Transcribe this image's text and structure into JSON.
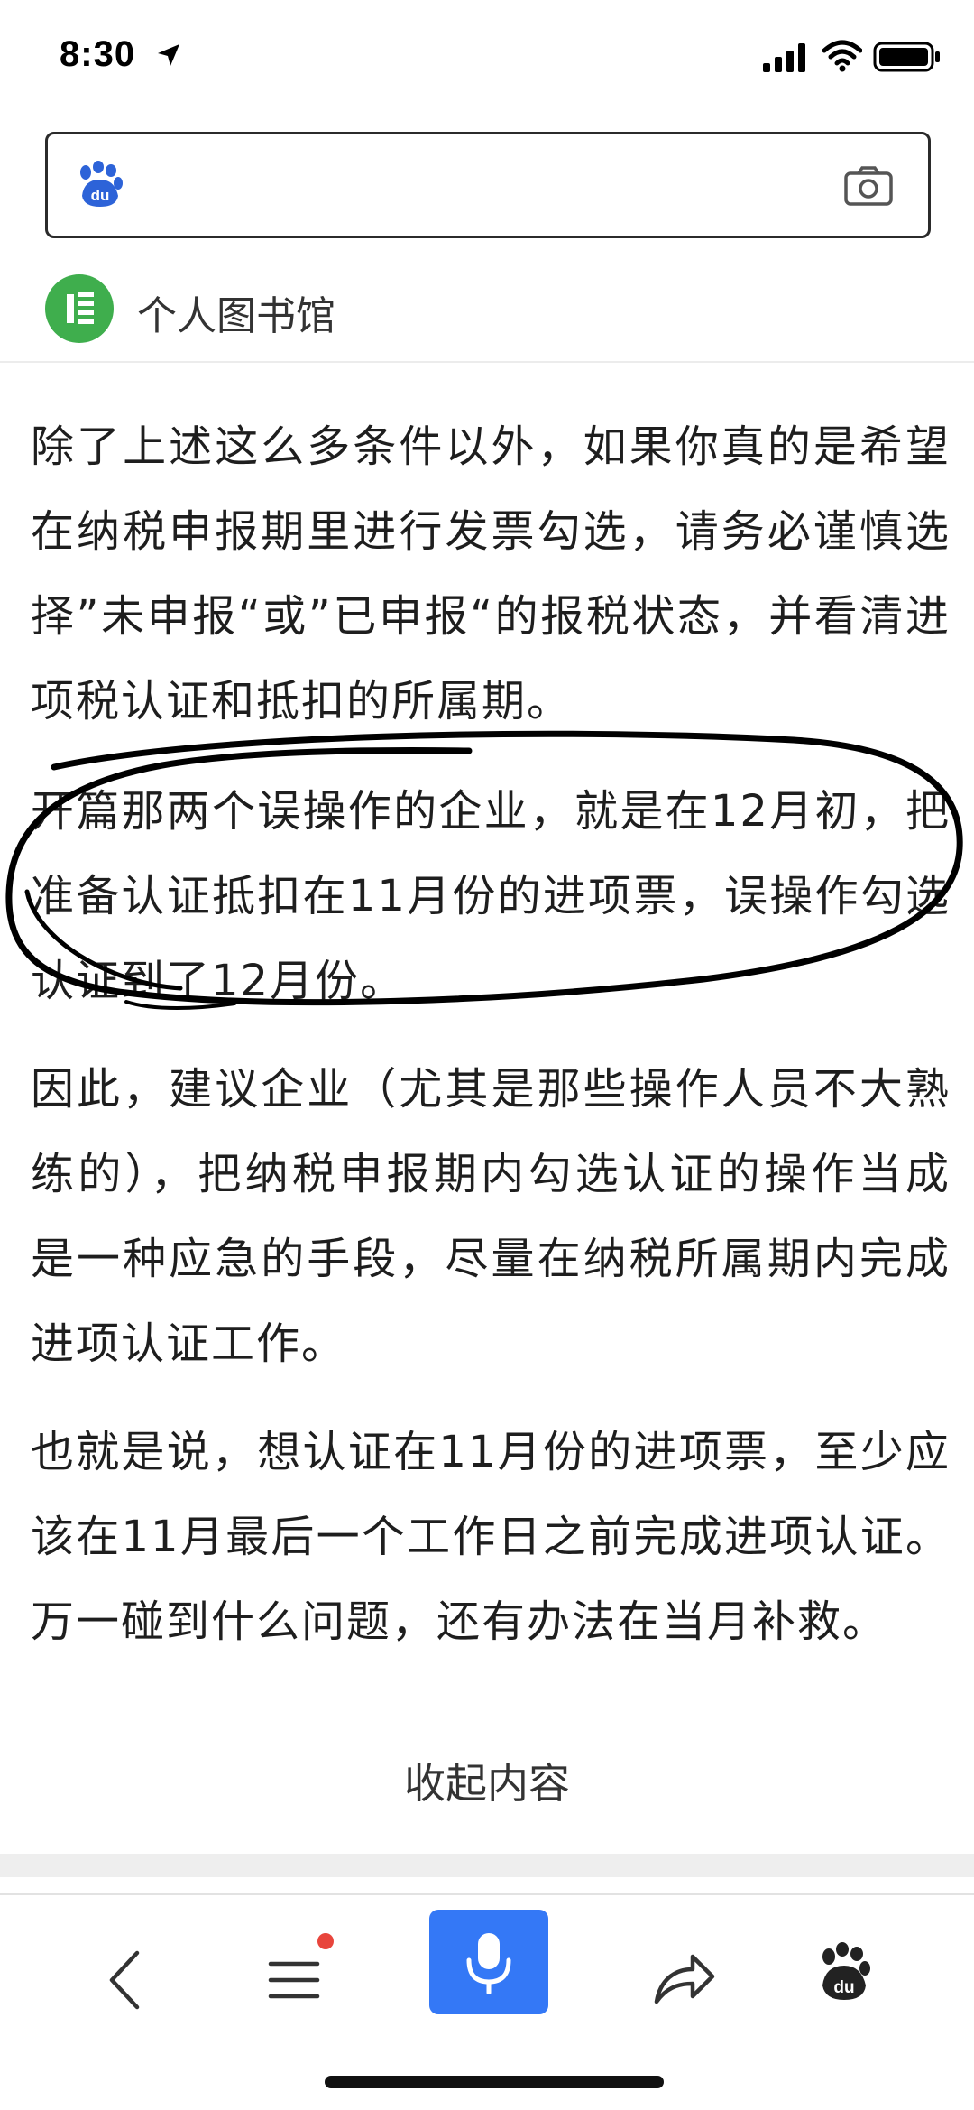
{
  "status_bar": {
    "time": "8:30"
  },
  "search": {
    "placeholder": ""
  },
  "source": {
    "name": "个人图书馆"
  },
  "article": {
    "paragraphs": [
      "除了上述这么多条件以外，如果你真的是希望在纳税申报期里进行发票勾选，请务必谨慎选择”未申报“或”已申报“的报税状态，并看清进项税认证和抵扣的所属期。",
      "开篇那两个误操作的企业，就是在12月初，把准备认证抵扣在11月份的进项票，误操作勾选认证到了12月份。",
      "因此，建议企业（尤其是那些操作人员不大熟练的），把纳税申报期内勾选认证的操作当成是一种应急的手段，尽量在纳税所属期内完成进项认证工作。",
      "也就是说，想认证在11月份的进项票，至少应该在11月最后一个工作日之前完成进项认证。万一碰到什么问题，还有办法在当月补救。"
    ]
  },
  "collapse_label": "收起内容",
  "bottom_nav": {
    "items": [
      "back-icon",
      "menu-icon",
      "microphone-icon",
      "share-icon",
      "baidu-paw-icon"
    ]
  },
  "colors": {
    "accent_blue": "#3478f6",
    "notification_red": "#e8453c",
    "source_green": "#3fae4d",
    "baidu_blue": "#2d63d8"
  }
}
